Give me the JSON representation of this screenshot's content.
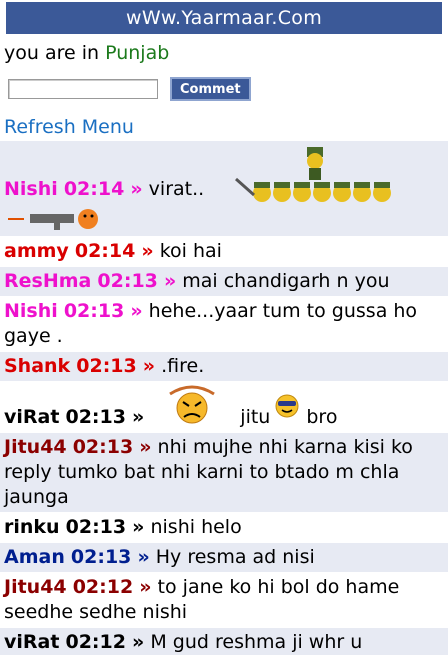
{
  "header": {
    "title": "wWw.Yaarmaar.Com"
  },
  "location": {
    "prefix": "you are in",
    "city": "Punjab"
  },
  "form": {
    "input_value": "",
    "button_label": "Commet"
  },
  "refresh_label": "Refresh Menu",
  "colors": {
    "header_bg": "#3b5998",
    "link": "#1a6fc2",
    "city": "#1c7a1c",
    "row_alt": "#e7eaf3"
  },
  "messages": [
    {
      "name": "Nishi",
      "time": "02:14",
      "sep": "»",
      "text": "virat..",
      "color": "#ee11cc",
      "emoticons": [
        "army-squad-icon",
        "gun-shooter-icon"
      ]
    },
    {
      "name": "ammy",
      "time": "02:14",
      "sep": "»",
      "text": "koi hai",
      "color": "#d90000"
    },
    {
      "name": "ResHma",
      "time": "02:13",
      "sep": "»",
      "text": "mai chandigarh n you",
      "color": "#ee11cc"
    },
    {
      "name": "Nishi",
      "time": "02:13",
      "sep": "»",
      "text": "hehe...yaar tum to gussa ho gaye .",
      "color": "#ee11cc"
    },
    {
      "name": "Shank",
      "time": "02:13",
      "sep": "»",
      "text": ".fire.",
      "color": "#d90000"
    },
    {
      "name": "viRat",
      "time": "02:13",
      "sep": "»",
      "text_a": "jitu",
      "text_b": "bro",
      "color": "#000000",
      "emoticons": [
        "angry-face-icon",
        "cool-face-icon"
      ]
    },
    {
      "name": "Jitu44",
      "time": "02:13",
      "sep": "»",
      "text": "nhi mujhe nhi karna kisi ko reply tumko bat nhi karni to btado m chla jaunga",
      "color": "#8b0000"
    },
    {
      "name": "rinku",
      "time": "02:13",
      "sep": "»",
      "text": "nishi helo",
      "color": "#000000"
    },
    {
      "name": "Aman",
      "time": "02:13",
      "sep": "»",
      "text": "Hy resma ad nisi",
      "color": "#001f8f"
    },
    {
      "name": "Jitu44",
      "time": "02:12",
      "sep": "»",
      "text": "to jane ko hi bol do hame seedhe sedhe nishi",
      "color": "#8b0000"
    },
    {
      "name": "viRat",
      "time": "02:12",
      "sep": "»",
      "text": "M gud reshma ji whr u",
      "color": "#000000"
    }
  ]
}
